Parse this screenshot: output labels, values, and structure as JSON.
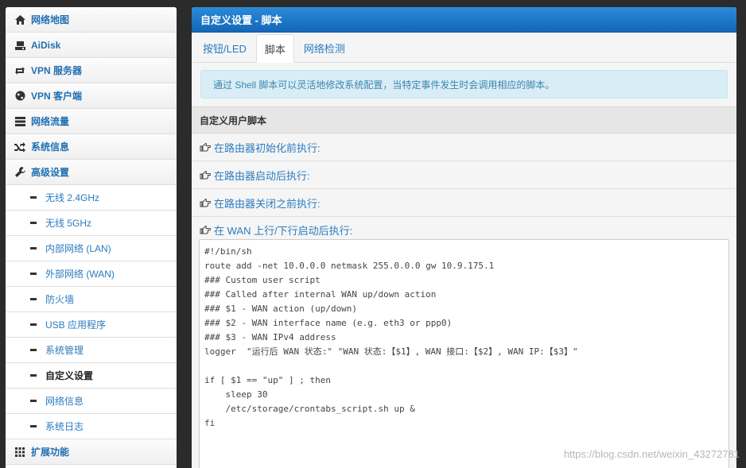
{
  "sidebar": {
    "items": [
      {
        "label": "网络地图",
        "icon": "home-icon"
      },
      {
        "label": "AiDisk",
        "icon": "hard-drive-icon"
      },
      {
        "label": "VPN 服务器",
        "icon": "retweet-icon"
      },
      {
        "label": "VPN 客户端",
        "icon": "globe-icon"
      },
      {
        "label": "网络流量",
        "icon": "list-icon"
      },
      {
        "label": "系统信息",
        "icon": "random-icon"
      },
      {
        "label": "高级设置",
        "icon": "wrench-icon"
      }
    ],
    "subitems": [
      {
        "label": "无线 2.4GHz"
      },
      {
        "label": "无线 5GHz"
      },
      {
        "label": "内部网络 (LAN)"
      },
      {
        "label": "外部网络 (WAN)"
      },
      {
        "label": "防火墙"
      },
      {
        "label": "USB 应用程序"
      },
      {
        "label": "系统管理"
      },
      {
        "label": "自定义设置"
      },
      {
        "label": "网络信息"
      },
      {
        "label": "系统日志"
      }
    ],
    "extra_item": {
      "label": "扩展功能",
      "icon": "grid-icon"
    },
    "active_sub": "自定义设置"
  },
  "main": {
    "title": "自定义设置 - 脚本",
    "tabs": [
      {
        "label": "按钮/LED"
      },
      {
        "label": "脚本"
      },
      {
        "label": "网络检测"
      }
    ],
    "active_tab": "脚本",
    "info": "通过 Shell 脚本可以灵活地修改系统配置，当特定事件发生时会调用相应的脚本。",
    "section_title": "自定义用户脚本",
    "scripts": [
      {
        "label": "在路由器初始化前执行:"
      },
      {
        "label": "在路由器启动后执行:"
      },
      {
        "label": "在路由器关闭之前执行:"
      },
      {
        "label": "在 WAN 上行/下行启动后执行:"
      }
    ],
    "editor_content": "#!/bin/sh\nroute add -net 10.0.0.0 netmask 255.0.0.0 gw 10.9.175.1\n### Custom user script\n### Called after internal WAN up/down action\n### $1 - WAN action (up/down)\n### $2 - WAN interface name (e.g. eth3 or ppp0)\n### $3 - WAN IPv4 address\nlogger  \"运行后 WAN 状态:\" \"WAN 状态:【$1】, WAN 接口:【$2】, WAN IP:【$3】\"\n\nif [ $1 == \"up\" ] ; then\n    sleep 30\n    /etc/storage/crontabs_script.sh up &\nfi"
  },
  "watermark": "https://blog.csdn.net/weixin_43272781",
  "colors": {
    "accent": "#1f6fb2",
    "header": "#1466b8",
    "info_bg": "#d9edf7",
    "info_text": "#3a87ad"
  }
}
